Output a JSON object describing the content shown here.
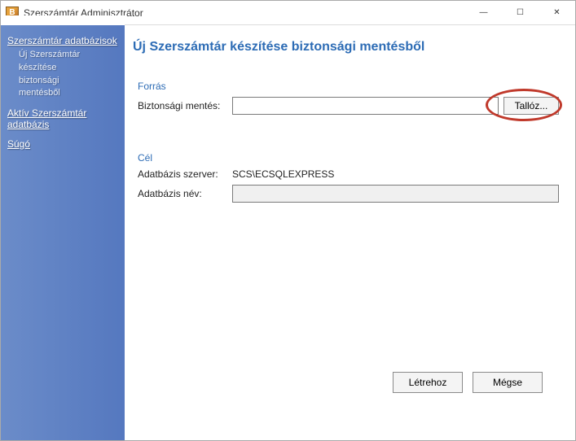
{
  "window": {
    "title": "Szerszámtár Adminisztrátor",
    "minimize": "—",
    "maximize": "☐",
    "close": "✕"
  },
  "sidebar": {
    "group1": {
      "title": "Szerszámtár adatbázisok",
      "sub1": "Új Szerszámtár",
      "sub2": "készítése",
      "sub3": "biztonsági",
      "sub4": "mentésből"
    },
    "group2": {
      "title": "Aktív Szerszámtár adatbázis"
    },
    "help": "Súgó"
  },
  "page": {
    "title": "Új Szerszámtár készítése biztonsági mentésből"
  },
  "source": {
    "section": "Forrás",
    "label": "Biztonsági mentés:",
    "value": "",
    "browse": "Tallóz..."
  },
  "target": {
    "section": "Cél",
    "server_label": "Adatbázis szerver:",
    "server_value": "SCS\\ECSQLEXPRESS",
    "dbname_label": "Adatbázis név:",
    "dbname_value": ""
  },
  "footer": {
    "create": "Létrehoz",
    "cancel": "Mégse"
  }
}
